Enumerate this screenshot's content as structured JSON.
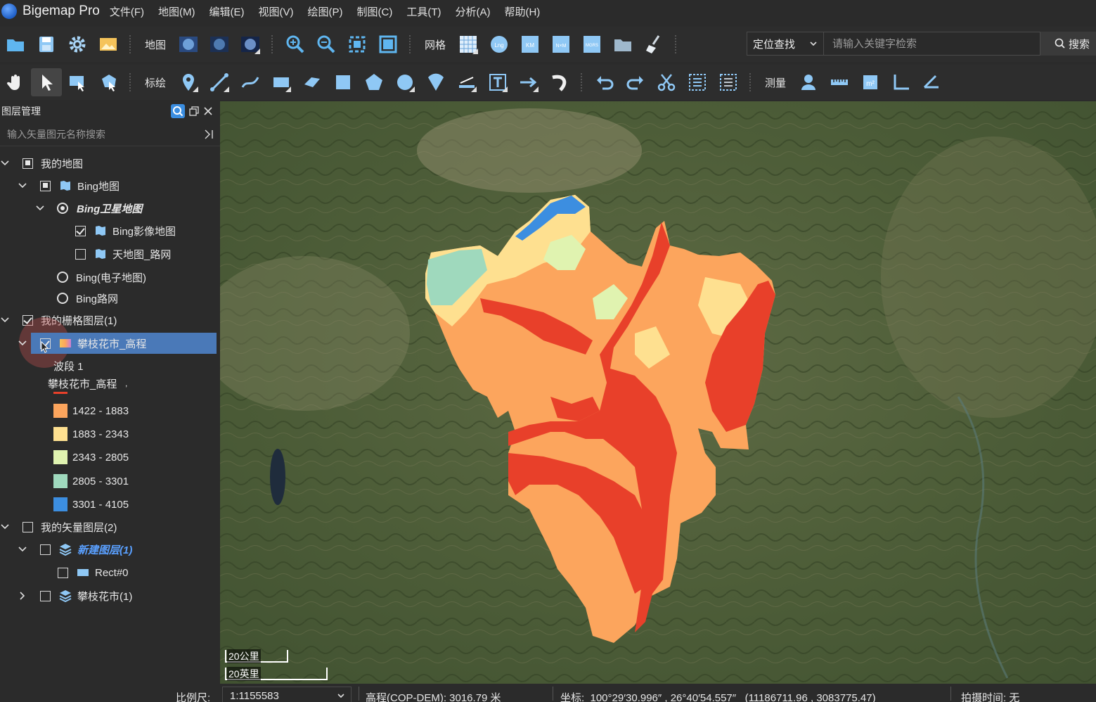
{
  "app": {
    "title": "Bigemap Pro"
  },
  "menu": [
    "文件(F)",
    "地图(M)",
    "编辑(E)",
    "视图(V)",
    "绘图(P)",
    "制图(C)",
    "工具(T)",
    "分析(A)",
    "帮助(H)"
  ],
  "toolbar1": {
    "map_label": "地图",
    "grid_label": "网格",
    "locate_select": "定位查找",
    "search_placeholder": "请输入关键字检索",
    "search_button": "搜索",
    "grid_icon_texts": {
      "lng": "Lng",
      "km": "KM",
      "nm": "N×M",
      "mgrs": "MGRS"
    }
  },
  "toolbar2": {
    "draw_label": "标绘",
    "measure_label": "测量"
  },
  "layer_panel": {
    "title": "图层管理",
    "search_placeholder": "输入矢量图元名称搜索",
    "tree": {
      "my_map": "我的地图",
      "bing": "Bing地图",
      "bing_satellite": "Bing卫星地图",
      "bing_imagery": "Bing影像地图",
      "tianditu_road": "天地图_路网",
      "bing_electronic": "Bing(电子地图)",
      "bing_road": "Bing路网",
      "raster_layers": "我的栅格图层(1)",
      "dem_layer": "攀枝花市_高程",
      "band": "波段 1",
      "legend_title": "攀枝花市_高程",
      "vector_layers": "我的矢量图层(2)",
      "new_layer": "新建图层(1)",
      "rect": "Rect#0",
      "panzhihua": "攀枝花市(1)"
    },
    "legend": [
      {
        "range": "1422 - 1883",
        "color": "#fca55d"
      },
      {
        "range": "1883 - 2343",
        "color": "#fee090"
      },
      {
        "range": "2343 - 2805",
        "color": "#e0f3b0"
      },
      {
        "range": "2805 - 3301",
        "color": "#9fd9bd"
      },
      {
        "range": "3301 - 4105",
        "color": "#3c8ee0"
      }
    ]
  },
  "map": {
    "scale_km": "20公里",
    "scale_mi": "20英里"
  },
  "status": {
    "scale_label": "比例尺:",
    "scale_value": "1:1155583",
    "elevation": "高程(COP-DEM):  3016.79 米",
    "coords": "坐标:  100°29′30.996″ , 26°40′54.557″   (11186711.96 , 3083775.47)",
    "capture_time": "拍摄时间:  无"
  },
  "colors": {
    "accent": "#4a79b8",
    "low_elev": "#e8402a"
  }
}
